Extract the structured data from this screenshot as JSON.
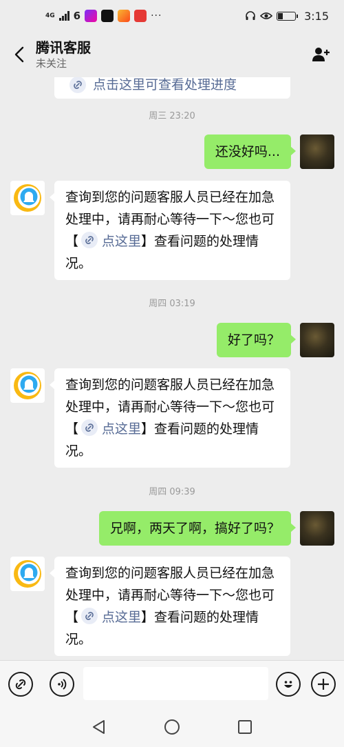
{
  "status_bar": {
    "network": "4G",
    "dots": "···",
    "time": "3:15"
  },
  "header": {
    "title": "腾讯客服",
    "subtitle": "未关注"
  },
  "messages": {
    "partial_top": "点击这里可查看处理进度",
    "ts1": "周三 23:20",
    "msg1": "还没好吗...",
    "reply_pre": "查询到您的问题客服人员已经在加急处理中，请再耐心等待一下～您也可【",
    "reply_link": "点这里",
    "reply_post": "】查看问题的处理情况。",
    "ts2": "周四 03:19",
    "msg2": "好了吗？",
    "ts3": "周四 09:39",
    "msg3": "兄啊，两天了啊，搞好了吗？"
  },
  "input_bar": {
    "placeholder": ""
  },
  "colors": {
    "accent_green": "#95ec69",
    "link_blue": "#576b95",
    "background": "#ededed"
  }
}
